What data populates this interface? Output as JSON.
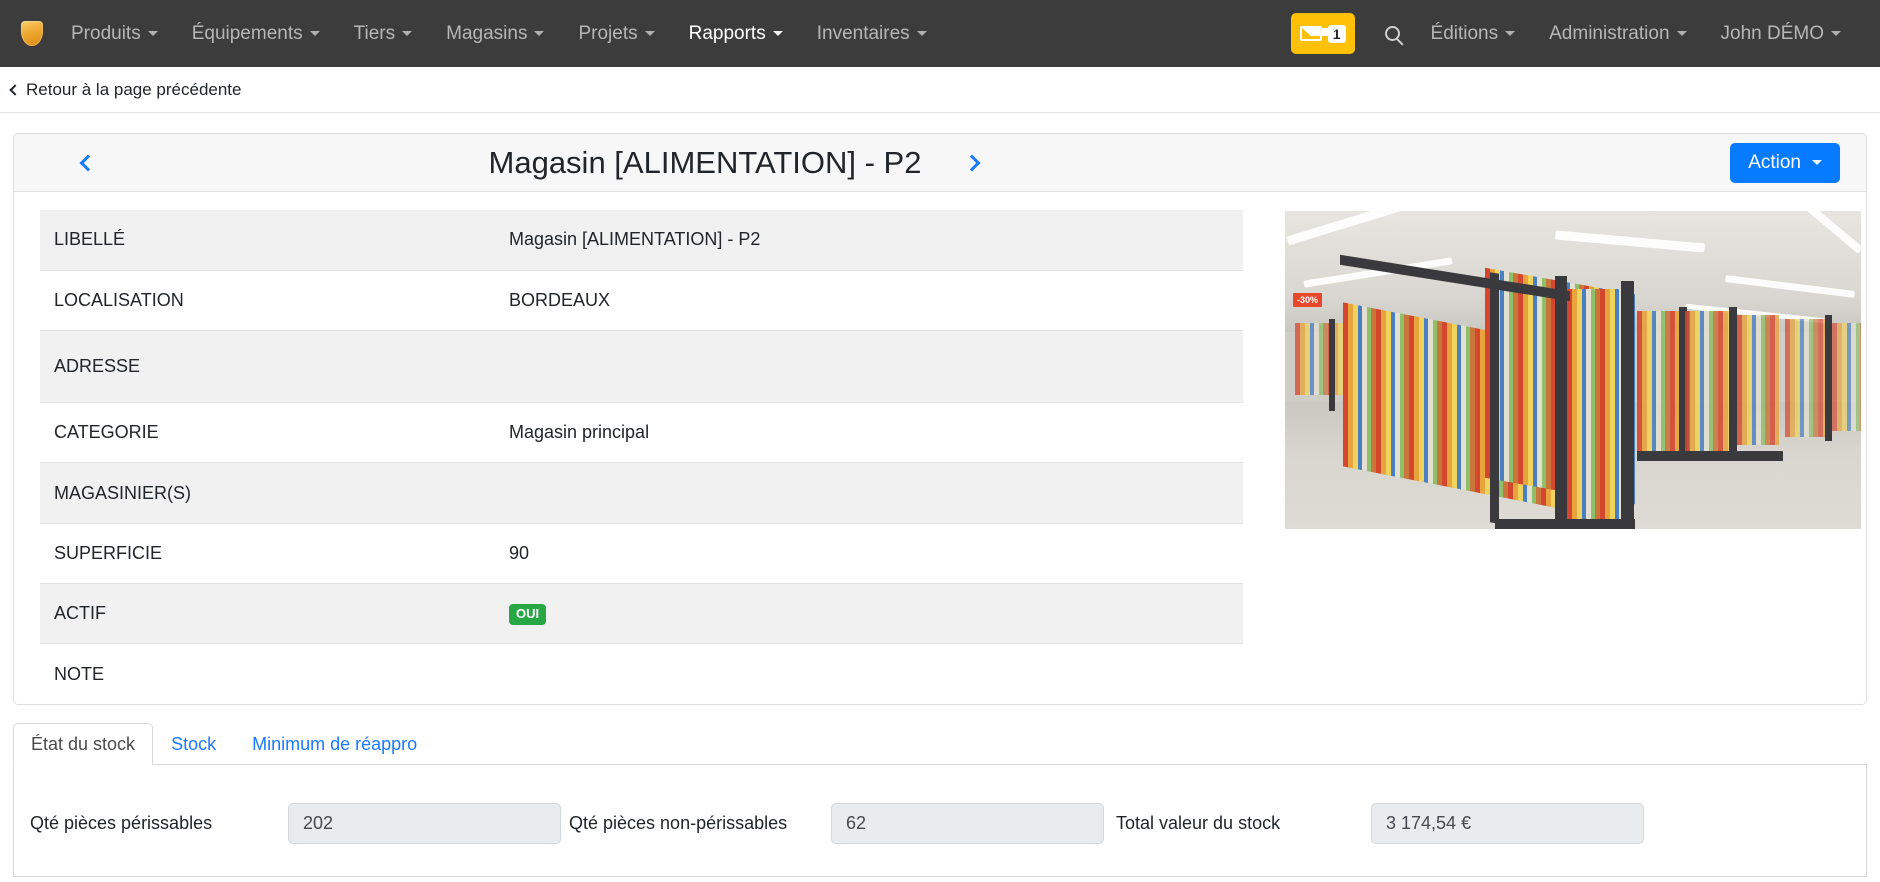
{
  "navbar": {
    "logo_icon": "shield-icon",
    "items": [
      {
        "label": "Produits",
        "active": false,
        "caret": true
      },
      {
        "label": "Équipements",
        "active": false,
        "caret": true
      },
      {
        "label": "Tiers",
        "active": false,
        "caret": true
      },
      {
        "label": "Magasins",
        "active": false,
        "caret": true
      },
      {
        "label": "Projets",
        "active": false,
        "caret": true
      },
      {
        "label": "Rapports",
        "active": true,
        "caret": true
      },
      {
        "label": "Inventaires",
        "active": false,
        "caret": true
      }
    ],
    "mail": {
      "icon": "envelope-icon",
      "count": "1",
      "color": "#ffc107"
    },
    "search_icon": "search-icon",
    "right_items": [
      {
        "label": "Éditions",
        "caret": true
      },
      {
        "label": "Administration",
        "caret": true
      },
      {
        "label": "John DÉMO",
        "caret": true
      }
    ]
  },
  "back_link": {
    "label": "Retour à la page précédente",
    "icon": "chevron-left-icon"
  },
  "header": {
    "prev_icon": "chevron-left-icon",
    "next_icon": "chevron-right-icon",
    "title": "Magasin [ALIMENTATION] - P2",
    "action_label": "Action",
    "action_color": "#067bff"
  },
  "details": {
    "rows": [
      {
        "label": "LIBELLÉ",
        "value": "Magasin [ALIMENTATION] - P2",
        "type": "text"
      },
      {
        "label": "LOCALISATION",
        "value": "BORDEAUX",
        "type": "text"
      },
      {
        "label": "ADRESSE",
        "value": "",
        "type": "text"
      },
      {
        "label": "CATEGORIE",
        "value": "Magasin principal",
        "type": "text"
      },
      {
        "label": "MAGASINIER(S)",
        "value": "",
        "type": "text"
      },
      {
        "label": "SUPERFICIE",
        "value": "90",
        "type": "text"
      },
      {
        "label": "ACTIF",
        "value": "OUI",
        "type": "badge"
      },
      {
        "label": "NOTE",
        "value": "",
        "type": "text"
      }
    ],
    "badge_color": "#28a745"
  },
  "photo": {
    "alt": "store-aisle-photo",
    "promo_tag": "-30%"
  },
  "tabs": [
    {
      "label": "État du stock",
      "active": true
    },
    {
      "label": "Stock",
      "active": false
    },
    {
      "label": "Minimum de réappro",
      "active": false
    }
  ],
  "stock_form": {
    "fields": [
      {
        "label": "Qté pièces périssables",
        "value": "202"
      },
      {
        "label": "Qté pièces non-périssables",
        "value": "62"
      },
      {
        "label": "Total valeur du stock",
        "value": "3 174,54 €"
      }
    ]
  }
}
